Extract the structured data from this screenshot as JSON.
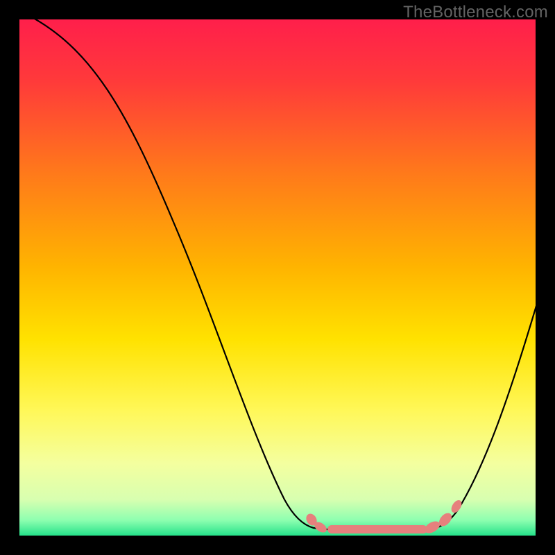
{
  "watermark": "TheBottleneck.com",
  "chart_data": {
    "type": "line",
    "title": "",
    "xlabel": "",
    "ylabel": "",
    "xlim": [
      0,
      100
    ],
    "ylim": [
      0,
      100
    ],
    "background_gradient": {
      "orientation": "vertical",
      "stops": [
        {
          "pos": 0.0,
          "color": "#ff1f4b"
        },
        {
          "pos": 0.12,
          "color": "#ff3a3a"
        },
        {
          "pos": 0.3,
          "color": "#ff7a1a"
        },
        {
          "pos": 0.48,
          "color": "#ffb400"
        },
        {
          "pos": 0.62,
          "color": "#ffe200"
        },
        {
          "pos": 0.76,
          "color": "#fff85a"
        },
        {
          "pos": 0.86,
          "color": "#f4ff9f"
        },
        {
          "pos": 0.93,
          "color": "#d8ffb0"
        },
        {
          "pos": 0.97,
          "color": "#8effb0"
        },
        {
          "pos": 1.0,
          "color": "#25e28a"
        }
      ]
    },
    "series": [
      {
        "name": "bottleneck-curve",
        "color": "#000000",
        "x": [
          3,
          10,
          20,
          30,
          40,
          48,
          55,
          60,
          78,
          82,
          86,
          90,
          95,
          100
        ],
        "values": [
          100,
          88,
          70,
          52,
          33,
          16,
          4,
          1,
          1,
          3,
          9,
          20,
          34,
          47
        ]
      },
      {
        "name": "highlight-segment",
        "color": "#e6807d",
        "x": [
          56,
          60,
          78,
          82,
          85
        ],
        "values": [
          3,
          1,
          1,
          2,
          5
        ]
      }
    ],
    "annotations": []
  }
}
